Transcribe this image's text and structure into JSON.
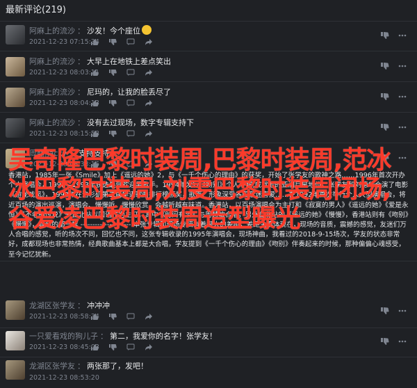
{
  "header": {
    "title": "最新评论(219)"
  },
  "comments": [
    {
      "user": "阿麻上的流沙",
      "sep": "：",
      "text": "沙发！今个座位",
      "date": "2021-12-23 07:15:34"
    },
    {
      "user": "阿麻上的流沙",
      "sep": "：",
      "text": "大早上在地铁上差点笑出",
      "date": "2021-12-23 08:03:11"
    },
    {
      "user": "阿麻上的流沙",
      "sep": "：",
      "text": "尼玛的，让我的脸丢尽了",
      "date": "2021-12-23 08:04:13"
    },
    {
      "user": "阿麻上的流沙",
      "sep": "：",
      "text": "没有去过现场，数字专辑支持下",
      "date": "2021-12-23 08:15:58"
    },
    {
      "user": "周翻|jacky",
      "sep": "：",
      "text": "支持支持",
      "date": "2021-12-23 08:33:16"
    },
    {
      "user": "龙湖区张学友",
      "sep": "：",
      "text": "冲冲冲",
      "date": "2021-12-23 08:58:34"
    },
    {
      "user": "一只爱看戏的狗儿子",
      "sep": "：",
      "text": "第二，我爱你的名字！张学友！",
      "date": "2021-12-23 08:45:03"
    },
    {
      "user": "龙湖区张学友",
      "sep": "：",
      "text": "两张那了，发吧！",
      "date": "2021-12-23 08:53:20"
    }
  ],
  "long_comment": {
    "text": "香港站，1985年一张《Smile》加上《遥远的她》2，与《一千个伤心的理由》的获奖，开始了张学友的歌神之路……1996年首次开办个人演唱会，1990—1993年获选最受欢迎男歌手。1994年发行《吻别》个人专辑,成就他的亚洲巨星地位，张学友和刘德华合演了电影《游龙戏凤》，1998年在洛杉矶第二届华语歌曲排行榜颁奖，歌声、形象深受各国歌迷喜爱……在1992年首次举行个人大型演唱会，将近百场的演出巡演，演唱会、慢慢听、慢慢欣赏、会越听越有味道。香港站，以百场演唱会为主打和《寂寞的男人》《遥远的她》《爱是永恒》《不老的传说》一台北站以国语作为主打，其中《时间有泪》与周慧敏合唱，另外台北站的《遥远的她》《慢慢》，香港站则有《吻别》《慢慢》，其余的都一样 --------------------- 本张专辑和现场专辑有着很大的差距，差距主要体现在，现场的音质，震撼的感觉，友迷们万人合唱的感觉，听的场次不同，回忆也不同，这张专辑收录的1995年演唱会，现场神曲，我看过的2018-9-15场次，学友的状态非常好，成都现场也非常热情，经典歌曲基本上都是大合唱，学友提到《一千个伤心的理由》《吻别》伴奏起来的时候，那种偏偏心魂感受，至今记忆犹新。"
  },
  "overlay": {
    "text": "吴奇隆巴黎时装周,巴黎时装周,范冰冰巴黎时装周,刘雯巴黎时装周闭场,谷爱凌巴黎时装周造型曝光"
  },
  "colors": {
    "background": "#1f2125",
    "overlay_red": "#fb3a2a",
    "muted": "#7f8590"
  },
  "icons": [
    "thumb-up-icon",
    "thumb-down-icon",
    "reply-icon",
    "share-icon",
    "more-icon",
    "dislike-icon"
  ]
}
